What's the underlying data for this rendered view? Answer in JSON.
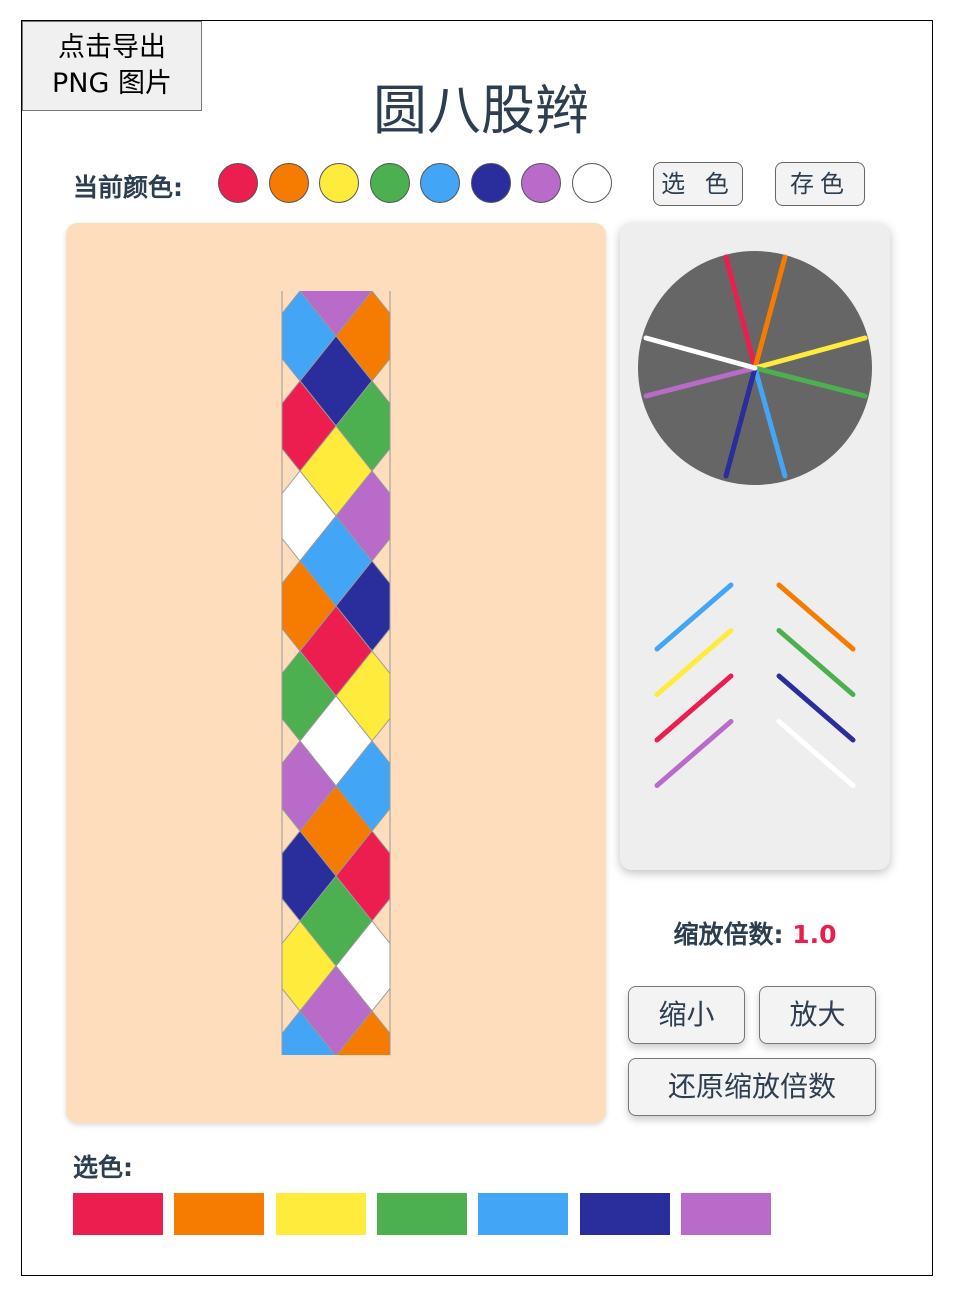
{
  "export_button": {
    "line1": "点击导出",
    "line2": "PNG 图片"
  },
  "title": "圆八股辫",
  "current_colors": {
    "label": "当前颜色:",
    "colors": [
      "#ec1e4f",
      "#f57c00",
      "#ffeb3b",
      "#4caf50",
      "#42a5f5",
      "#2a2d9c",
      "#b86bc8",
      "#ffffff"
    ]
  },
  "toolbar": {
    "pick_color": "选 色",
    "save_color": "存色"
  },
  "zoom": {
    "label": "缩放倍数: ",
    "value": "1.0"
  },
  "buttons": {
    "zoom_out": "缩小",
    "zoom_in": "放大",
    "reset": "还原缩放倍数"
  },
  "palette": {
    "label": "选色:",
    "colors": [
      "#ec1e4f",
      "#f57c00",
      "#ffeb3b",
      "#4caf50",
      "#42a5f5",
      "#2a2d9c",
      "#b86bc8",
      "#ffffff"
    ]
  },
  "braid_pattern": {
    "tile_cycle": [
      "#ffeb3b",
      "#ffffff",
      "#b86bc8",
      "#42a5f5",
      "#f57c00",
      "#2a2d9c",
      "#ec1e4f",
      "#4caf50"
    ]
  },
  "dial": {
    "background": "#666666",
    "strands": [
      "#ec1e4f",
      "#f57c00",
      "#ffeb3b",
      "#4caf50",
      "#42a5f5",
      "#2a2d9c",
      "#b86bc8",
      "#ffffff"
    ]
  },
  "strand_preview": {
    "left": [
      "#42a5f5",
      "#ffeb3b",
      "#ec1e4f",
      "#b86bc8"
    ],
    "right": [
      "#f57c00",
      "#4caf50",
      "#2a2d9c",
      "#ffffff"
    ]
  }
}
